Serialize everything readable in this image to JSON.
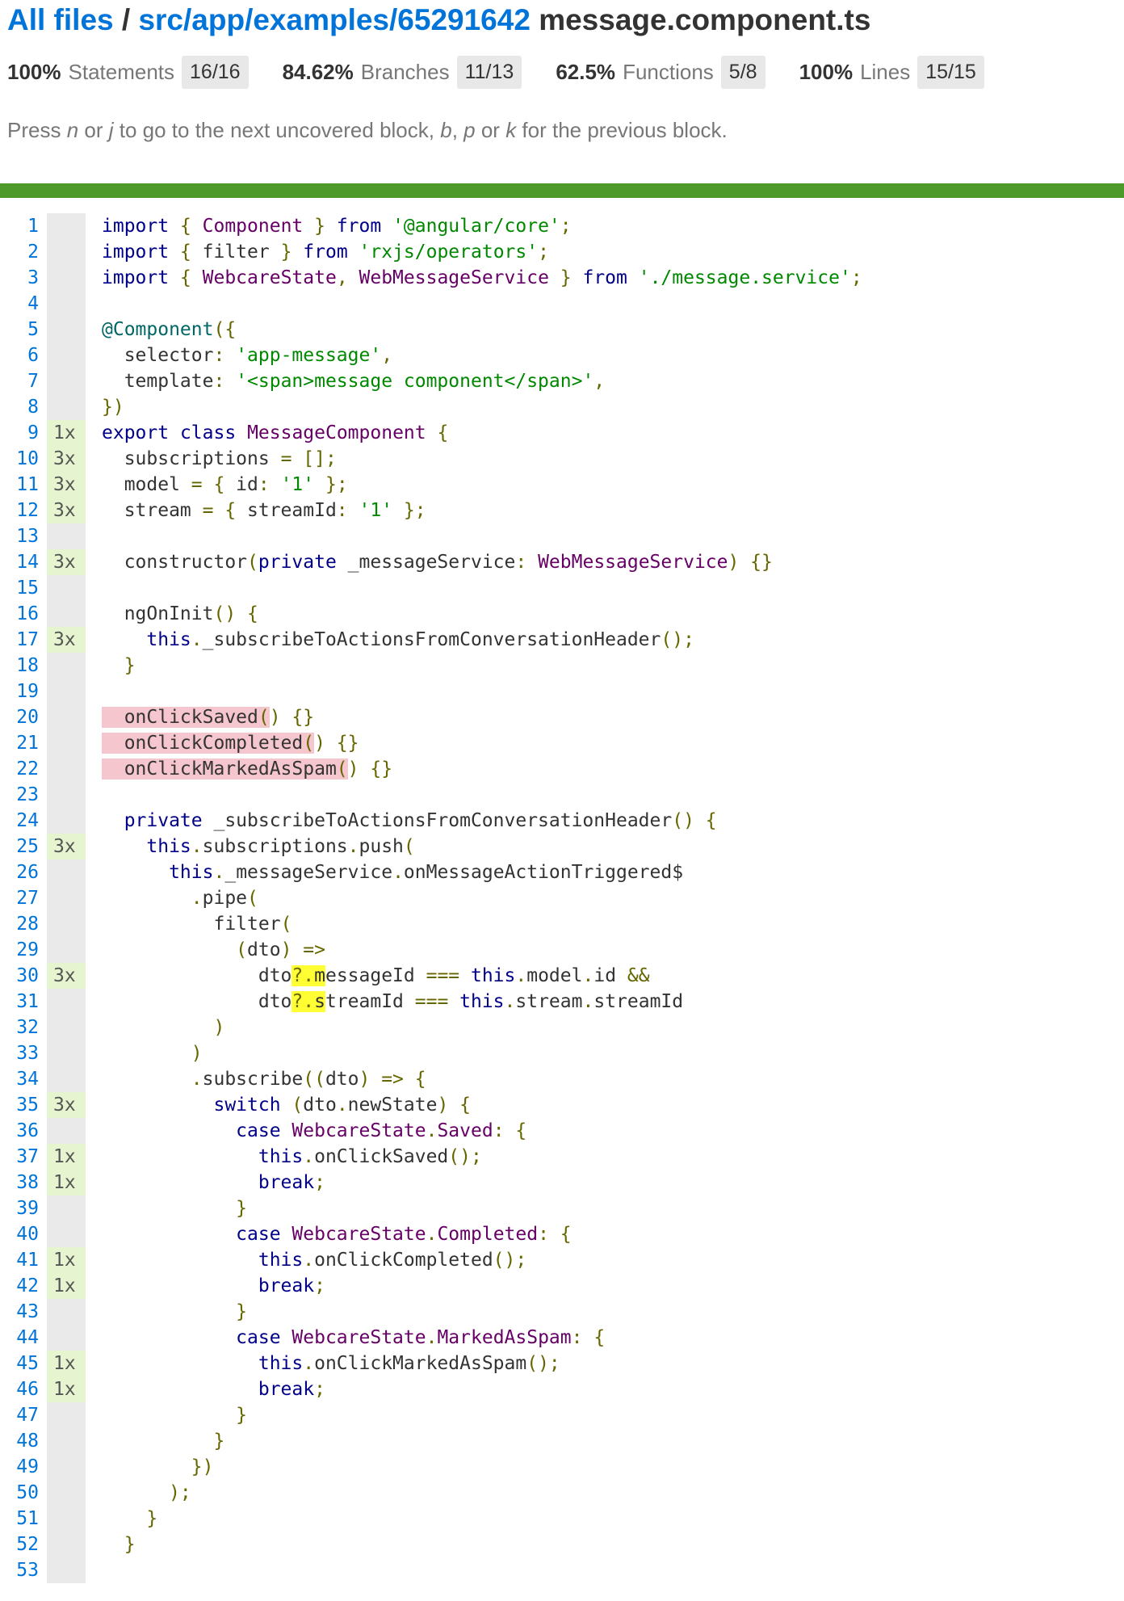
{
  "header": {
    "all_files_link": "All files",
    "separator": "/",
    "path_link": "src/app/examples/65291642",
    "file_name": "message.component.ts"
  },
  "stats": [
    {
      "pct": "100%",
      "label": "Statements",
      "fraction": "16/16"
    },
    {
      "pct": "84.62%",
      "label": "Branches",
      "fraction": "11/13"
    },
    {
      "pct": "62.5%",
      "label": "Functions",
      "fraction": "5/8"
    },
    {
      "pct": "100%",
      "label": "Lines",
      "fraction": "15/15"
    }
  ],
  "hint": {
    "t1": "Press ",
    "k1": "n",
    "t2": " or ",
    "k2": "j",
    "t3": " to go to the next uncovered block, ",
    "k3": "b",
    "t4": ", ",
    "k4": "p",
    "t5": " or ",
    "k5": "k",
    "t6": " for the previous block."
  },
  "colors": {
    "link": "#0074d9",
    "coverage_bar": "#4d9a2a",
    "hit_count_bg": "#e6f5d0",
    "uncovered_bg": "#f6c6ce",
    "branch_highlight": "#ffff33"
  },
  "code_lines": [
    {
      "n": "1",
      "c": "",
      "t": [
        [
          "kw",
          "import"
        ],
        [
          "pun",
          " { "
        ],
        [
          "typ",
          "Component"
        ],
        [
          "pun",
          " } "
        ],
        [
          "",
          ""
        ],
        [
          "kw",
          "from"
        ],
        [
          "pun",
          " "
        ],
        [
          "str",
          "'@angular/core'"
        ],
        [
          "pun",
          ";"
        ]
      ]
    },
    {
      "n": "2",
      "c": "",
      "t": [
        [
          "kw",
          "import"
        ],
        [
          "pun",
          " { "
        ],
        [
          "",
          "filter"
        ],
        [
          "pun",
          " } "
        ],
        [
          "kw",
          "from"
        ],
        [
          "pun",
          " "
        ],
        [
          "str",
          "'rxjs/operators'"
        ],
        [
          "pun",
          ";"
        ]
      ]
    },
    {
      "n": "3",
      "c": "",
      "t": [
        [
          "kw",
          "import"
        ],
        [
          "pun",
          " { "
        ],
        [
          "typ",
          "WebcareState"
        ],
        [
          "pun",
          ", "
        ],
        [
          "typ",
          "WebMessageService"
        ],
        [
          "pun",
          " } "
        ],
        [
          "kw",
          "from"
        ],
        [
          "pun",
          " "
        ],
        [
          "str",
          "'./message.service'"
        ],
        [
          "pun",
          ";"
        ]
      ]
    },
    {
      "n": "4",
      "c": "",
      "t": []
    },
    {
      "n": "5",
      "c": "",
      "t": [
        [
          "dec",
          "@Component"
        ],
        [
          "pun",
          "({"
        ]
      ]
    },
    {
      "n": "6",
      "c": "",
      "t": [
        [
          "",
          "  selector"
        ],
        [
          "pun",
          ": "
        ],
        [
          "str",
          "'app-message'"
        ],
        [
          "pun",
          ","
        ]
      ]
    },
    {
      "n": "7",
      "c": "",
      "t": [
        [
          "",
          "  template"
        ],
        [
          "pun",
          ": "
        ],
        [
          "str",
          "'<span>message component</span>'"
        ],
        [
          "pun",
          ","
        ]
      ]
    },
    {
      "n": "8",
      "c": "",
      "t": [
        [
          "pun",
          "})"
        ]
      ]
    },
    {
      "n": "9",
      "c": "1x",
      "t": [
        [
          "kw",
          "export"
        ],
        [
          "",
          " "
        ],
        [
          "kw",
          "class"
        ],
        [
          "",
          " "
        ],
        [
          "typ",
          "MessageComponent"
        ],
        [
          "pun",
          " {"
        ]
      ]
    },
    {
      "n": "10",
      "c": "3x",
      "t": [
        [
          "",
          "  subscriptions "
        ],
        [
          "pun",
          "= [];"
        ]
      ]
    },
    {
      "n": "11",
      "c": "3x",
      "t": [
        [
          "",
          "  model "
        ],
        [
          "pun",
          "= { "
        ],
        [
          "",
          "id"
        ],
        [
          "pun",
          ": "
        ],
        [
          "str",
          "'1'"
        ],
        [
          "pun",
          " };"
        ]
      ]
    },
    {
      "n": "12",
      "c": "3x",
      "t": [
        [
          "",
          "  stream "
        ],
        [
          "pun",
          "= { "
        ],
        [
          "",
          "streamId"
        ],
        [
          "pun",
          ": "
        ],
        [
          "str",
          "'1'"
        ],
        [
          "pun",
          " };"
        ]
      ]
    },
    {
      "n": "13",
      "c": "",
      "t": []
    },
    {
      "n": "14",
      "c": "3x",
      "t": [
        [
          "",
          "  constructor"
        ],
        [
          "pun",
          "("
        ],
        [
          "kw",
          "private"
        ],
        [
          "",
          " _messageService"
        ],
        [
          "pun",
          ": "
        ],
        [
          "typ",
          "WebMessageService"
        ],
        [
          "pun",
          ") {}"
        ]
      ]
    },
    {
      "n": "15",
      "c": "",
      "t": []
    },
    {
      "n": "16",
      "c": "",
      "t": [
        [
          "",
          "  ngOnInit"
        ],
        [
          "pun",
          "() {"
        ]
      ]
    },
    {
      "n": "17",
      "c": "3x",
      "t": [
        [
          "kw",
          "    this"
        ],
        [
          "pun",
          "."
        ],
        [
          "",
          "_subscribeToActionsFromConversationHeader"
        ],
        [
          "pun",
          "();"
        ]
      ]
    },
    {
      "n": "18",
      "c": "",
      "t": [
        [
          "pun",
          "  }"
        ]
      ]
    },
    {
      "n": "19",
      "c": "",
      "t": []
    },
    {
      "n": "20",
      "c": "",
      "t": [
        [
          "miss",
          "  onClickSaved"
        ],
        [
          "miss pun",
          "("
        ],
        [
          "pun",
          ") {}"
        ]
      ]
    },
    {
      "n": "21",
      "c": "",
      "t": [
        [
          "miss",
          "  onClickCompleted"
        ],
        [
          "miss pun",
          "("
        ],
        [
          "pun",
          ") {}"
        ]
      ]
    },
    {
      "n": "22",
      "c": "",
      "t": [
        [
          "miss",
          "  onClickMarkedAsSpam"
        ],
        [
          "miss pun",
          "("
        ],
        [
          "pun",
          ") {}"
        ]
      ]
    },
    {
      "n": "23",
      "c": "",
      "t": []
    },
    {
      "n": "24",
      "c": "",
      "t": [
        [
          "kw",
          "  private"
        ],
        [
          "",
          " _subscribeToActionsFromConversationHeader"
        ],
        [
          "pun",
          "() {"
        ]
      ]
    },
    {
      "n": "25",
      "c": "3x",
      "t": [
        [
          "kw",
          "    this"
        ],
        [
          "pun",
          "."
        ],
        [
          "",
          "subscriptions"
        ],
        [
          "pun",
          "."
        ],
        [
          "",
          "push"
        ],
        [
          "pun",
          "("
        ]
      ]
    },
    {
      "n": "26",
      "c": "",
      "t": [
        [
          "kw",
          "      this"
        ],
        [
          "pun",
          "."
        ],
        [
          "",
          "_messageService"
        ],
        [
          "pun",
          "."
        ],
        [
          "",
          "onMessageActionTriggered$"
        ]
      ]
    },
    {
      "n": "27",
      "c": "",
      "t": [
        [
          "pun",
          "        ."
        ],
        [
          "",
          "pipe"
        ],
        [
          "pun",
          "("
        ]
      ]
    },
    {
      "n": "28",
      "c": "",
      "t": [
        [
          "",
          "          filter"
        ],
        [
          "pun",
          "("
        ]
      ]
    },
    {
      "n": "29",
      "c": "",
      "t": [
        [
          "pun",
          "            ("
        ],
        [
          "",
          "dto"
        ],
        [
          "pun",
          ") =>"
        ]
      ]
    },
    {
      "n": "30",
      "c": "3x",
      "t": [
        [
          "",
          "              dto"
        ],
        [
          "hl pun",
          "?."
        ],
        [
          "hl",
          "m"
        ],
        [
          "",
          "essageId "
        ],
        [
          "pun",
          "=== "
        ],
        [
          "kw",
          "this"
        ],
        [
          "pun",
          "."
        ],
        [
          "",
          "model"
        ],
        [
          "pun",
          "."
        ],
        [
          "",
          "id "
        ],
        [
          "pun",
          "&&"
        ]
      ]
    },
    {
      "n": "31",
      "c": "",
      "t": [
        [
          "",
          "              dto"
        ],
        [
          "hl pun",
          "?."
        ],
        [
          "hl",
          "s"
        ],
        [
          "",
          "treamId "
        ],
        [
          "pun",
          "=== "
        ],
        [
          "kw",
          "this"
        ],
        [
          "pun",
          "."
        ],
        [
          "",
          "stream"
        ],
        [
          "pun",
          "."
        ],
        [
          "",
          "streamId"
        ]
      ]
    },
    {
      "n": "32",
      "c": "",
      "t": [
        [
          "pun",
          "          )"
        ]
      ]
    },
    {
      "n": "33",
      "c": "",
      "t": [
        [
          "pun",
          "        )"
        ]
      ]
    },
    {
      "n": "34",
      "c": "",
      "t": [
        [
          "pun",
          "        ."
        ],
        [
          "",
          "subscribe"
        ],
        [
          "pun",
          "(("
        ],
        [
          "",
          "dto"
        ],
        [
          "pun",
          ") => {"
        ]
      ]
    },
    {
      "n": "35",
      "c": "3x",
      "t": [
        [
          "kw",
          "          switch"
        ],
        [
          "pun",
          " ("
        ],
        [
          "",
          "dto"
        ],
        [
          "pun",
          "."
        ],
        [
          "",
          "newState"
        ],
        [
          "pun",
          ") {"
        ]
      ]
    },
    {
      "n": "36",
      "c": "",
      "t": [
        [
          "kw",
          "            case"
        ],
        [
          "",
          " "
        ],
        [
          "typ",
          "WebcareState"
        ],
        [
          "pun",
          "."
        ],
        [
          "typ",
          "Saved"
        ],
        [
          "pun",
          ": {"
        ]
      ]
    },
    {
      "n": "37",
      "c": "1x",
      "t": [
        [
          "kw",
          "              this"
        ],
        [
          "pun",
          "."
        ],
        [
          "",
          "onClickSaved"
        ],
        [
          "pun",
          "();"
        ]
      ]
    },
    {
      "n": "38",
      "c": "1x",
      "t": [
        [
          "kw",
          "              break"
        ],
        [
          "pun",
          ";"
        ]
      ]
    },
    {
      "n": "39",
      "c": "",
      "t": [
        [
          "pun",
          "            }"
        ]
      ]
    },
    {
      "n": "40",
      "c": "",
      "t": [
        [
          "kw",
          "            case"
        ],
        [
          "",
          " "
        ],
        [
          "typ",
          "WebcareState"
        ],
        [
          "pun",
          "."
        ],
        [
          "typ",
          "Completed"
        ],
        [
          "pun",
          ": {"
        ]
      ]
    },
    {
      "n": "41",
      "c": "1x",
      "t": [
        [
          "kw",
          "              this"
        ],
        [
          "pun",
          "."
        ],
        [
          "",
          "onClickCompleted"
        ],
        [
          "pun",
          "();"
        ]
      ]
    },
    {
      "n": "42",
      "c": "1x",
      "t": [
        [
          "kw",
          "              break"
        ],
        [
          "pun",
          ";"
        ]
      ]
    },
    {
      "n": "43",
      "c": "",
      "t": [
        [
          "pun",
          "            }"
        ]
      ]
    },
    {
      "n": "44",
      "c": "",
      "t": [
        [
          "kw",
          "            case"
        ],
        [
          "",
          " "
        ],
        [
          "typ",
          "WebcareState"
        ],
        [
          "pun",
          "."
        ],
        [
          "typ",
          "MarkedAsSpam"
        ],
        [
          "pun",
          ": {"
        ]
      ]
    },
    {
      "n": "45",
      "c": "1x",
      "t": [
        [
          "kw",
          "              this"
        ],
        [
          "pun",
          "."
        ],
        [
          "",
          "onClickMarkedAsSpam"
        ],
        [
          "pun",
          "();"
        ]
      ]
    },
    {
      "n": "46",
      "c": "1x",
      "t": [
        [
          "kw",
          "              break"
        ],
        [
          "pun",
          ";"
        ]
      ]
    },
    {
      "n": "47",
      "c": "",
      "t": [
        [
          "pun",
          "            }"
        ]
      ]
    },
    {
      "n": "48",
      "c": "",
      "t": [
        [
          "pun",
          "          }"
        ]
      ]
    },
    {
      "n": "49",
      "c": "",
      "t": [
        [
          "pun",
          "        })"
        ]
      ]
    },
    {
      "n": "50",
      "c": "",
      "t": [
        [
          "pun",
          "      );"
        ]
      ]
    },
    {
      "n": "51",
      "c": "",
      "t": [
        [
          "pun",
          "    }"
        ]
      ]
    },
    {
      "n": "52",
      "c": "",
      "t": [
        [
          "pun",
          "  }"
        ]
      ]
    },
    {
      "n": "53",
      "c": "",
      "t": []
    }
  ]
}
